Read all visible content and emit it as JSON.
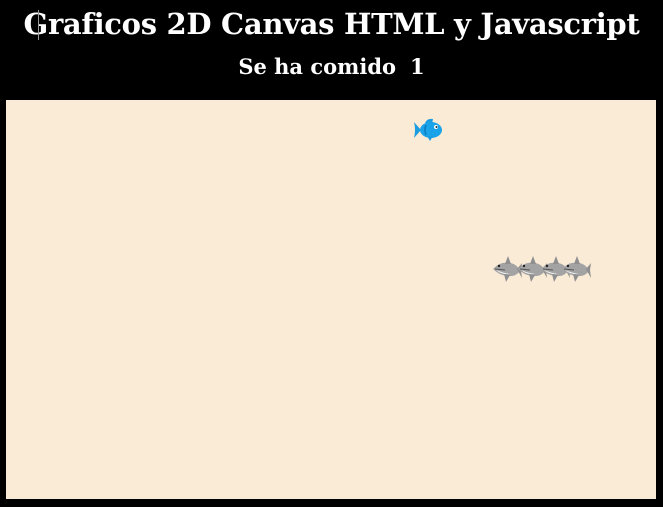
{
  "header": {
    "title": "Graficos 2D Canvas HTML y Javascript",
    "score_label": "Se ha comido",
    "score_value": "1"
  },
  "game": {
    "background_color": "#faebd7",
    "fish": {
      "icon": "fish-icon",
      "color": "#1aa3e8"
    },
    "snake": {
      "icon": "shark-icon",
      "color": "#a3a3a3",
      "segments": 4
    }
  }
}
